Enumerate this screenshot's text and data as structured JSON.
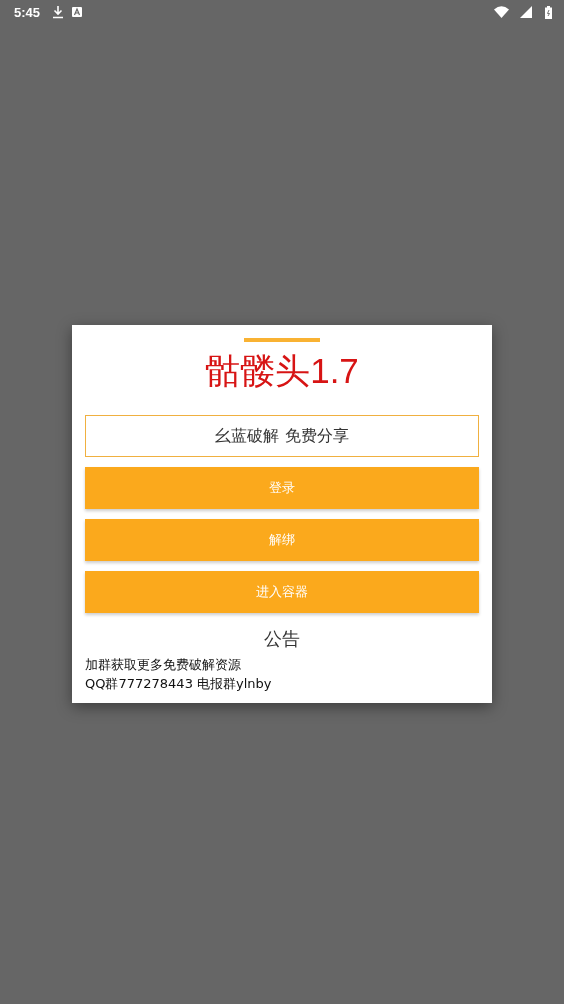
{
  "status_bar": {
    "time": "5:45"
  },
  "dialog": {
    "title": "骷髅头1.7",
    "subtitle": "幺蓝破解 免费分享",
    "buttons": [
      "登录",
      "解绑",
      "进入容器"
    ],
    "notice": {
      "heading": "公告",
      "lines": [
        "加群获取更多免费破解资源",
        "QQ群777278443  电报群ylnby"
      ]
    }
  }
}
